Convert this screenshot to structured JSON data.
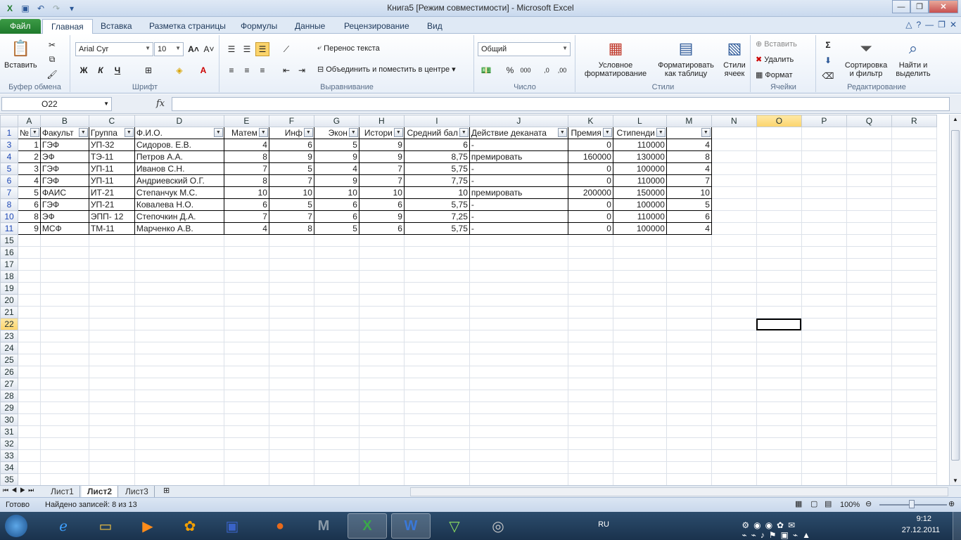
{
  "window": {
    "title": "Книга5  [Режим совместимости]  -  Microsoft Excel"
  },
  "tabs": [
    "Файл",
    "Главная",
    "Вставка",
    "Разметка страницы",
    "Формулы",
    "Данные",
    "Рецензирование",
    "Вид"
  ],
  "ribbon": {
    "clipboard": {
      "paste": "Вставить",
      "label": "Буфер обмена"
    },
    "font": {
      "name": "Arial Cyr",
      "size": "10",
      "bold": "Ж",
      "italic": "К",
      "underline": "Ч",
      "label": "Шрифт"
    },
    "alignment": {
      "wrap": "Перенос текста",
      "merge": "Объединить и поместить в центре",
      "label": "Выравнивание"
    },
    "number": {
      "format": "Общий",
      "label": "Число"
    },
    "styles": {
      "conditional": "Условное форматирование",
      "as_table": "Форматировать как таблицу",
      "cell_styles": "Стили ячеек",
      "label": "Стили"
    },
    "cells": {
      "insert": "Вставить",
      "delete": "Удалить",
      "format": "Формат",
      "label": "Ячейки"
    },
    "editing": {
      "sort": "Сортировка и фильтр",
      "find": "Найти и выделить",
      "label": "Редактирование"
    }
  },
  "formula_bar": {
    "name_box": "O22",
    "fx": "fx",
    "value": ""
  },
  "columns": [
    "A",
    "B",
    "C",
    "D",
    "E",
    "F",
    "G",
    "H",
    "I",
    "J",
    "K",
    "L",
    "M",
    "N",
    "O",
    "P",
    "Q",
    "R"
  ],
  "header_row": [
    "№",
    "Факульт",
    "Группа",
    "Ф.И.О.",
    "Матем",
    "Инф",
    "Экон",
    "Истори",
    "Средний бал",
    "Действие деканата",
    "Премия",
    "Стипенди",
    ""
  ],
  "rows": [
    {
      "row": "3",
      "cells": [
        "1",
        "ГЭФ",
        "УП-32",
        "Сидоров. Е.В.",
        "4",
        "6",
        "5",
        "9",
        "6",
        "-",
        "0",
        "110000",
        "4"
      ]
    },
    {
      "row": "4",
      "cells": [
        "2",
        "ЭФ",
        "ТЭ-11",
        "Петров А.А.",
        "8",
        "9",
        "9",
        "9",
        "8,75",
        "премировать",
        "160000",
        "130000",
        "8"
      ]
    },
    {
      "row": "5",
      "cells": [
        "3",
        "ГЭФ",
        "УП-11",
        "Иванов С.Н.",
        "7",
        "5",
        "4",
        "7",
        "5,75",
        "-",
        "0",
        "100000",
        "4"
      ]
    },
    {
      "row": "6",
      "cells": [
        "4",
        "ГЭФ",
        "УП-11",
        "Андриевский О.Г.",
        "8",
        "7",
        "9",
        "7",
        "7,75",
        "-",
        "0",
        "110000",
        "7"
      ]
    },
    {
      "row": "7",
      "cells": [
        "5",
        "ФАИС",
        "ИТ-21",
        "Степанчук М.С.",
        "10",
        "10",
        "10",
        "10",
        "10",
        "премировать",
        "200000",
        "150000",
        "10"
      ]
    },
    {
      "row": "8",
      "cells": [
        "6",
        "ГЭФ",
        "УП-21",
        "Ковалева Н.О.",
        "6",
        "5",
        "6",
        "6",
        "5,75",
        "-",
        "0",
        "100000",
        "5"
      ]
    },
    {
      "row": "10",
      "cells": [
        "8",
        "ЭФ",
        "ЭПП- 12",
        "Степочкин Д.А.",
        "7",
        "7",
        "6",
        "9",
        "7,25",
        "-",
        "0",
        "110000",
        "6"
      ]
    },
    {
      "row": "11",
      "cells": [
        "9",
        "МСФ",
        "ТМ-11",
        "Марченко А.В.",
        "4",
        "8",
        "5",
        "6",
        "5,75",
        "-",
        "0",
        "100000",
        "4"
      ]
    }
  ],
  "empty_rows": [
    "15",
    "16",
    "17",
    "18",
    "19",
    "20",
    "21",
    "22",
    "23",
    "24",
    "25",
    "26",
    "27",
    "28",
    "29",
    "30",
    "31",
    "32",
    "33",
    "34",
    "35"
  ],
  "sheets": [
    "Лист1",
    "Лист2",
    "Лист3"
  ],
  "status": {
    "ready": "Готово",
    "found": "Найдено записей: 8 из 13",
    "zoom": "100%"
  },
  "tray": {
    "lang": "RU",
    "time": "9:12",
    "date": "27.12.2011"
  }
}
